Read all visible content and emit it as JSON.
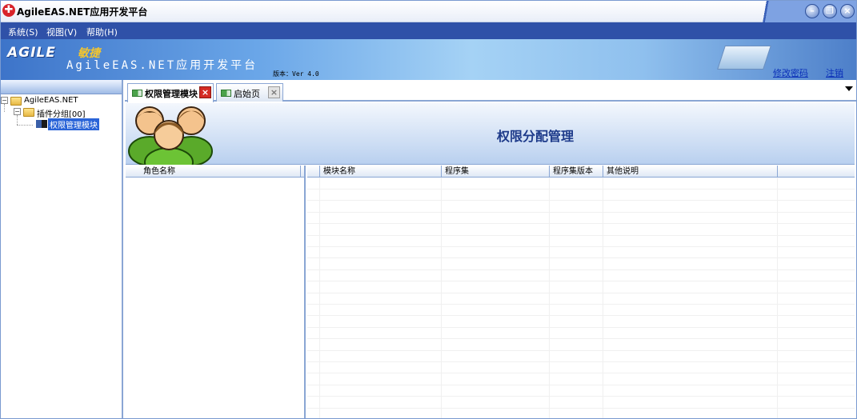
{
  "window": {
    "title": "AgileEAS.NET应用开发平台",
    "controls": [
      "minimize-icon",
      "restore-icon",
      "close-icon"
    ]
  },
  "menu": {
    "items": [
      {
        "label": "系统(S)"
      },
      {
        "label": "视图(V)"
      },
      {
        "label": "帮助(H)"
      }
    ]
  },
  "banner": {
    "logo_text": "AGILE",
    "logo_cn": "敏捷",
    "product_name": "AgileEAS.NET应用开发平台",
    "version": "版本：Ver 4.0",
    "change_password": "修改密码",
    "logout": "注销"
  },
  "tree": {
    "root": "AgileEAS.NET",
    "group": "插件分组[00]",
    "module": "权限管理模块"
  },
  "tabs": [
    {
      "label": "权限管理模块",
      "active": true
    },
    {
      "label": "启始页",
      "active": false
    }
  ],
  "content": {
    "title": "权限分配管理"
  },
  "role_grid": {
    "columns": [
      "角色名称"
    ]
  },
  "module_grid": {
    "columns": [
      "模块名称",
      "程序集",
      "程序集版本",
      "其他说明"
    ]
  },
  "colors": {
    "menubar": "#2f51a8",
    "accent": "#2a64d8",
    "title_text": "#1d3a8a"
  }
}
